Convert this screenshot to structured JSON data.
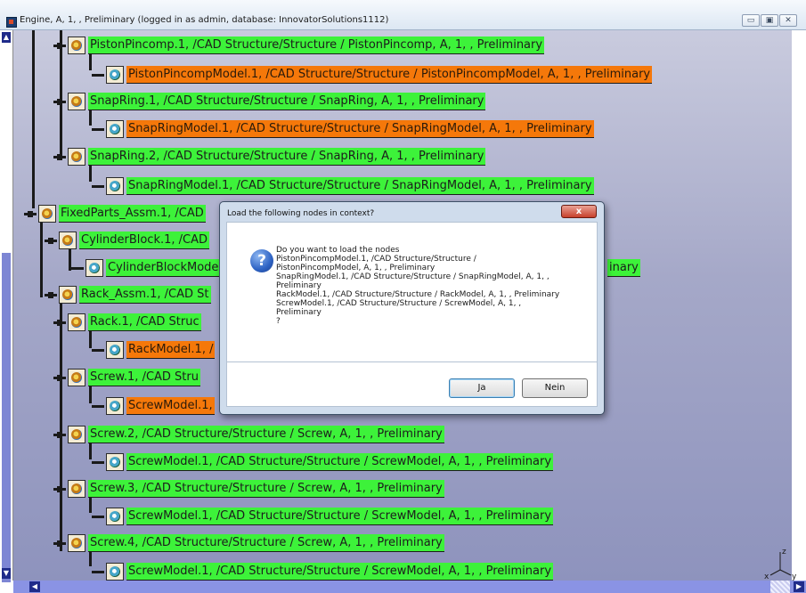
{
  "window": {
    "title": "Engine, A, 1, , Preliminary (logged in as admin, database: InnovatorSolutions1112)",
    "buttons": [
      "▭",
      "▣",
      "✕"
    ]
  },
  "tree": {
    "nodes": [
      {
        "label": "PistonPincomp.1, /CAD Structure/Structure / PistonPincomp, A, 1, , Preliminary",
        "color": "green"
      },
      {
        "label": "PistonPincompModel.1, /CAD Structure/Structure / PistonPincompModel, A, 1, , Preliminary",
        "color": "orange"
      },
      {
        "label": "SnapRing.1, /CAD Structure/Structure / SnapRing, A, 1, , Preliminary",
        "color": "green"
      },
      {
        "label": "SnapRingModel.1, /CAD Structure/Structure / SnapRingModel, A, 1, , Preliminary",
        "color": "orange"
      },
      {
        "label": "SnapRing.2, /CAD Structure/Structure / SnapRing, A, 1, , Preliminary",
        "color": "green"
      },
      {
        "label": "SnapRingModel.1, /CAD Structure/Structure / SnapRingModel, A, 1, , Preliminary",
        "color": "green"
      },
      {
        "label": "FixedParts_Assm.1, /CAD",
        "color": "green"
      },
      {
        "label": "CylinderBlock.1, /CAD",
        "color": "green"
      },
      {
        "label": "CylinderBlockMode",
        "color": "green"
      },
      {
        "label": "inary",
        "color": "green"
      },
      {
        "label": "Rack_Assm.1, /CAD St",
        "color": "green"
      },
      {
        "label": "Rack.1, /CAD Struc",
        "color": "green"
      },
      {
        "label": "RackModel.1, /",
        "color": "orange"
      },
      {
        "label": "Screw.1, /CAD Stru",
        "color": "green"
      },
      {
        "label": "ScrewModel.1,",
        "color": "orange"
      },
      {
        "label": "Screw.2, /CAD Structure/Structure / Screw, A, 1, , Preliminary",
        "color": "green"
      },
      {
        "label": "ScrewModel.1, /CAD Structure/Structure / ScrewModel, A, 1, , Preliminary",
        "color": "green"
      },
      {
        "label": "Screw.3, /CAD Structure/Structure / Screw, A, 1, , Preliminary",
        "color": "green"
      },
      {
        "label": "ScrewModel.1, /CAD Structure/Structure / ScrewModel, A, 1, , Preliminary",
        "color": "green"
      },
      {
        "label": "Screw.4, /CAD Structure/Structure / Screw, A, 1, , Preliminary",
        "color": "green"
      },
      {
        "label": "ScrewModel.1, /CAD Structure/Structure / ScrewModel, A, 1, , Preliminary",
        "color": "green"
      }
    ]
  },
  "dialog": {
    "title": "Load the following nodes in context?",
    "close_label": "x",
    "message_lines": [
      "Do you want to load the nodes",
      "PistonPincompModel.1, /CAD Structure/Structure /",
      "PistonPincompModel, A, 1, , Preliminary",
      "SnapRingModel.1, /CAD Structure/Structure / SnapRingModel, A, 1, ,",
      "Preliminary",
      "RackModel.1, /CAD Structure/Structure / RackModel, A, 1, , Preliminary",
      "ScrewModel.1, /CAD Structure/Structure / ScrewModel, A, 1, ,",
      "Preliminary",
      "?"
    ],
    "yes_label": "Ja",
    "no_label": "Nein"
  },
  "axis": {
    "z": "z",
    "x": "x",
    "y": "y"
  },
  "colors": {
    "green": "#3df23a",
    "orange": "#f5780a",
    "background": "#a5a8c8"
  }
}
